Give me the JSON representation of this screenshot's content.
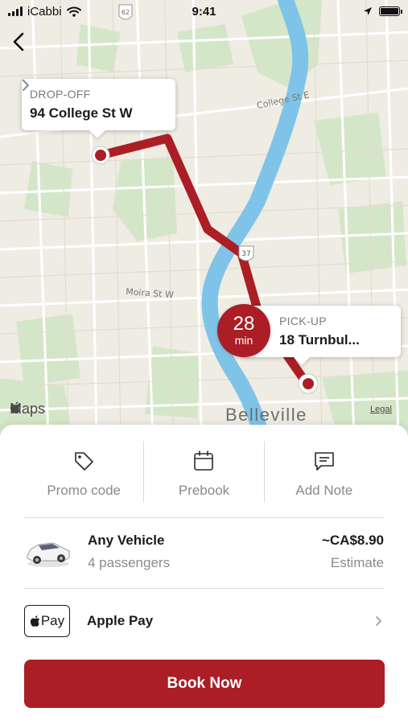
{
  "status_bar": {
    "carrier": "iCabbi",
    "time": "9:41"
  },
  "map": {
    "dropoff": {
      "label": "DROP-OFF",
      "address": "94 College St W"
    },
    "pickup": {
      "label": "PICK-UP",
      "address": "18 Turnbul..."
    },
    "eta": {
      "value": "28",
      "unit": "min"
    },
    "street_labels": {
      "college_st_e": "College St E",
      "moira_st_w": "Moira St W",
      "route_37": "37",
      "route_62": "62"
    },
    "city_label": "Belleville",
    "maps_brand": "Maps",
    "legal_link": "Legal",
    "route_color": "#ab1e26",
    "water_color": "#7fc4e8",
    "park_color": "#d4e6c8"
  },
  "actions": [
    {
      "label": "Promo code",
      "icon": "tag-icon"
    },
    {
      "label": "Prebook",
      "icon": "calendar-icon"
    },
    {
      "label": "Add Note",
      "icon": "note-icon"
    }
  ],
  "vehicle": {
    "name": "Any Vehicle",
    "passengers": "4 passengers",
    "price": "~CA$8.90",
    "price_note": "Estimate"
  },
  "payment": {
    "badge_text": "Pay",
    "method": "Apple Pay"
  },
  "book_button": {
    "label": "Book Now",
    "color": "#ab1e26"
  }
}
